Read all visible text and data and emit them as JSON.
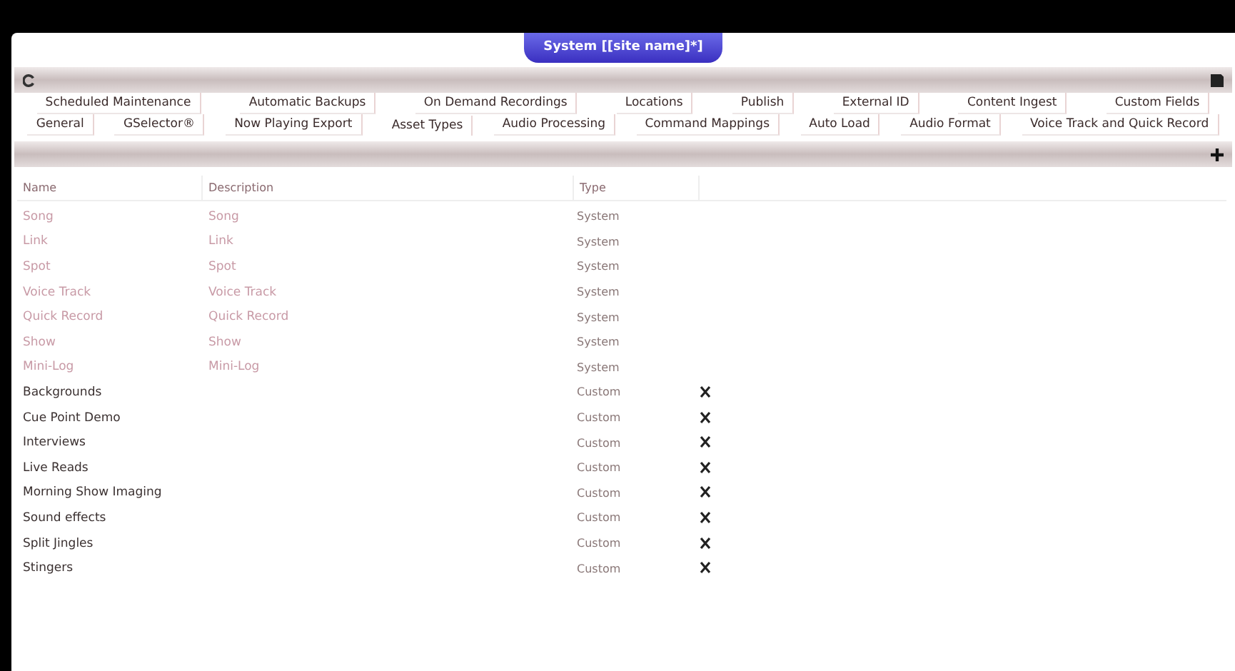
{
  "window": {
    "title": "System [[site name]*]"
  },
  "tab_rows": [
    [
      {
        "label": "Scheduled Maintenance",
        "selected": false
      },
      {
        "label": "Automatic Backups",
        "selected": false
      },
      {
        "label": "On Demand Recordings",
        "selected": false
      },
      {
        "label": "Locations",
        "selected": false
      },
      {
        "label": "Publish",
        "selected": false
      },
      {
        "label": "External ID",
        "selected": false
      },
      {
        "label": "Content Ingest",
        "selected": false
      },
      {
        "label": "Custom Fields",
        "selected": false
      }
    ],
    [
      {
        "label": "General",
        "selected": false
      },
      {
        "label": "GSelector®",
        "selected": false
      },
      {
        "label": "Now Playing Export",
        "selected": false
      },
      {
        "label": "Asset Types",
        "selected": true
      },
      {
        "label": "Audio Processing",
        "selected": false
      },
      {
        "label": "Command Mappings",
        "selected": false
      },
      {
        "label": "Auto Load",
        "selected": false
      },
      {
        "label": "Audio Format",
        "selected": false
      },
      {
        "label": "Voice Track and Quick Record",
        "selected": false
      }
    ]
  ],
  "table": {
    "columns": [
      "Name",
      "Description",
      "Type"
    ],
    "rows": [
      {
        "kind": "system",
        "name": "Song",
        "description": "Song",
        "type": "System"
      },
      {
        "kind": "system",
        "name": "Link",
        "description": "Link",
        "type": "System"
      },
      {
        "kind": "system",
        "name": "Spot",
        "description": "Spot",
        "type": "System"
      },
      {
        "kind": "system",
        "name": "Voice Track",
        "description": "Voice Track",
        "type": "System"
      },
      {
        "kind": "system",
        "name": "Quick Record",
        "description": "Quick Record",
        "type": "System"
      },
      {
        "kind": "system",
        "name": "Show",
        "description": "Show",
        "type": "System"
      },
      {
        "kind": "system",
        "name": "Mini-Log",
        "description": "Mini-Log",
        "type": "System"
      },
      {
        "kind": "custom",
        "name": "Backgrounds",
        "type": "Custom"
      },
      {
        "kind": "custom",
        "name": "Cue Point Demo",
        "type": "Custom"
      },
      {
        "kind": "custom",
        "name": "Interviews",
        "type": "Custom"
      },
      {
        "kind": "custom",
        "name": "Live Reads",
        "type": "Custom"
      },
      {
        "kind": "custom",
        "name": "Morning Show Imaging",
        "type": "Custom"
      },
      {
        "kind": "custom",
        "name": "Sound effects",
        "type": "Custom"
      },
      {
        "kind": "custom",
        "name": "Split Jingles",
        "type": "Custom"
      },
      {
        "kind": "custom",
        "name": "Stingers",
        "type": "Custom"
      }
    ]
  }
}
